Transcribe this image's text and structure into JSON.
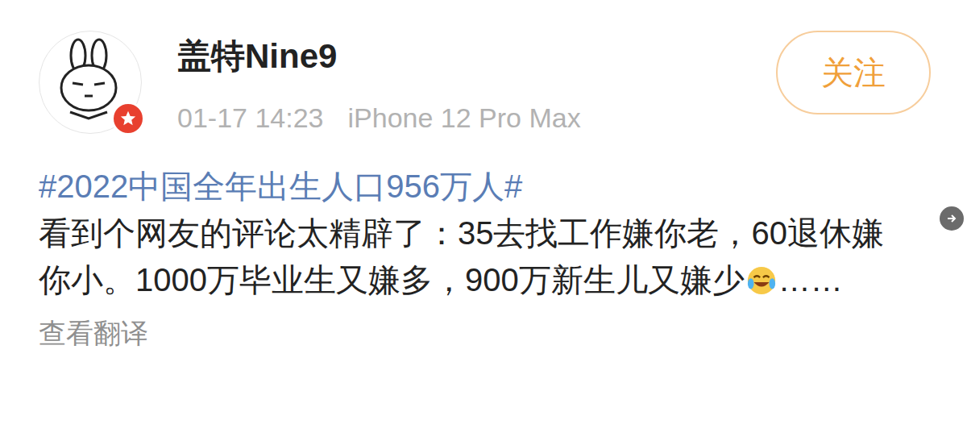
{
  "post": {
    "author": {
      "name": "盖特Nine9",
      "verified": true
    },
    "time": "01-17 14:23",
    "device": "iPhone 12 Pro Max",
    "follow_button": {
      "label": "关注",
      "followed": false
    },
    "hashtag": "#2022中国全年出生人口956万人#",
    "body": "看到个网友的评论太精辟了：35去找工作嫌你老，60退休嫌你小。1000万毕业生又嫌多，900万新生儿又嫌少",
    "ending": "……",
    "translate_link": "查看翻译"
  }
}
